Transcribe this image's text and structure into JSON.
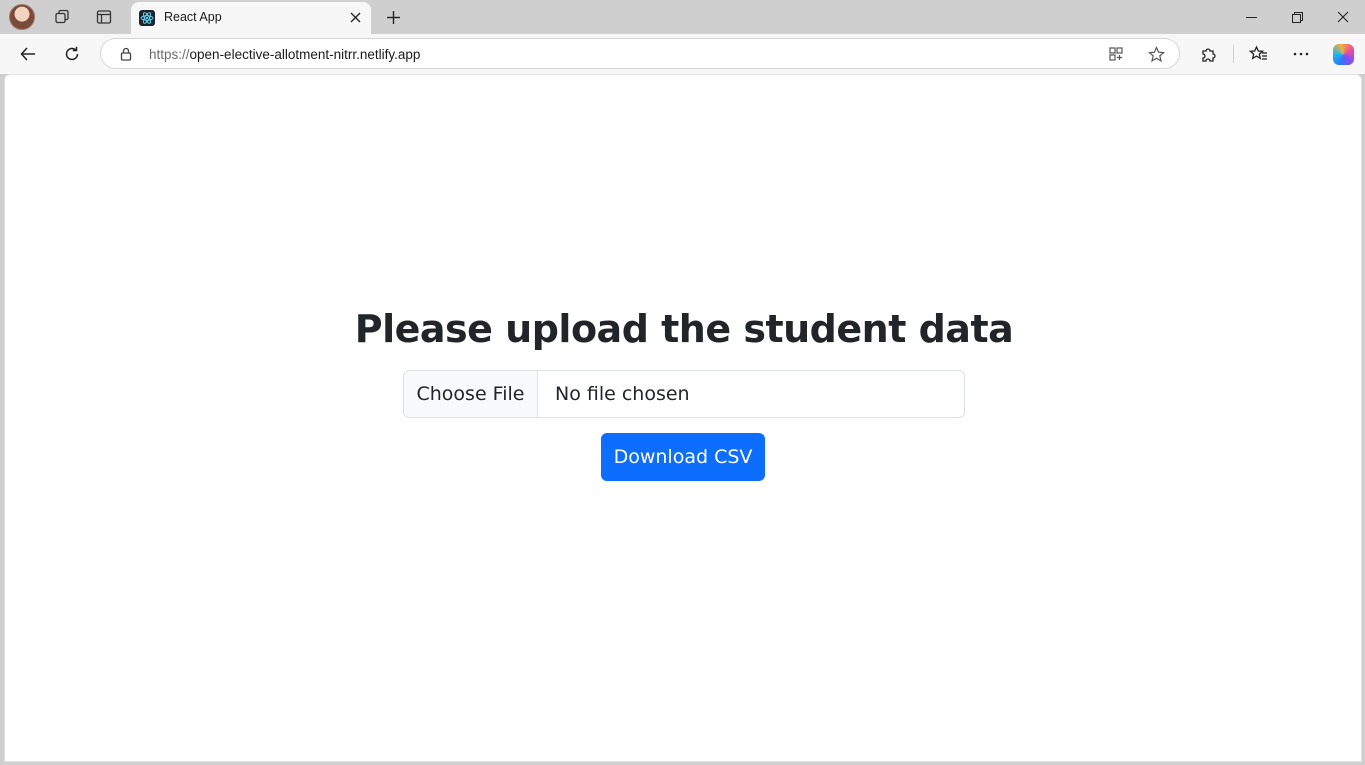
{
  "browser": {
    "tab": {
      "title": "React App"
    },
    "address_bar": {
      "protocol": "https://",
      "host": "open-elective-allotment-nitrr.netlify.app"
    }
  },
  "page": {
    "heading": "Please upload the student data",
    "file_input": {
      "button_label": "Choose File",
      "status": "No file chosen"
    },
    "download_button": {
      "label": "Download CSV"
    }
  },
  "colors": {
    "primary_button": "#0d6efd",
    "heading_text": "#212529",
    "tab_strip": "#cfcfcf",
    "toolbar": "#f7f7f7"
  }
}
